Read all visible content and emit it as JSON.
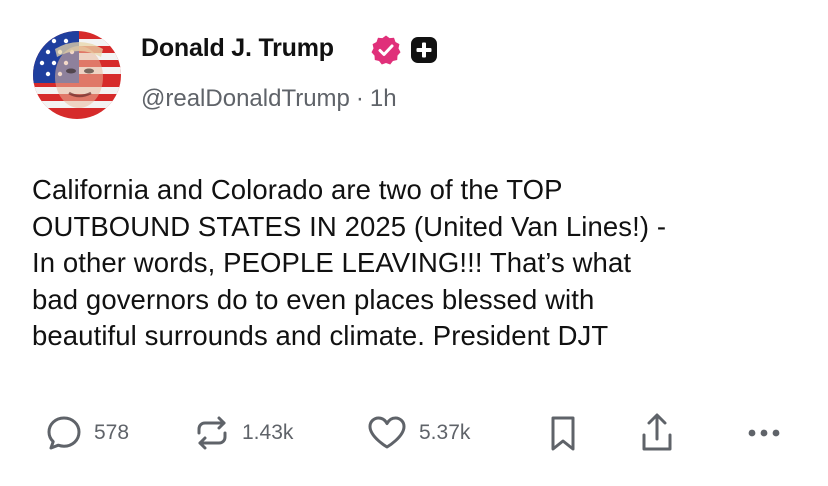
{
  "post": {
    "author": {
      "name": "Donald J. Trump",
      "handle": "@realDonaldTrump",
      "separator": "·",
      "time": "1h",
      "verified": true,
      "badge_color": "#e0307a"
    },
    "text_lines": [
      "California and Colorado are two of the TOP",
      "OUTBOUND STATES IN 2025 (United Van Lines!) -",
      "In other words, PEOPLE LEAVING!!! That’s what",
      "bad governors do to even places blessed with",
      "beautiful surrounds and climate. President DJT"
    ],
    "actions": {
      "replies": "578",
      "reposts": "1.43k",
      "likes": "5.37k"
    },
    "icons": {
      "reply": "speech-bubble-icon",
      "repost": "repost-arrows-icon",
      "like": "heart-icon",
      "bookmark": "bookmark-icon",
      "share": "share-upload-icon",
      "more": "ellipsis-icon"
    }
  },
  "colors": {
    "text": "#111111",
    "secondary": "#5f6369",
    "verified": "#e0307a"
  }
}
